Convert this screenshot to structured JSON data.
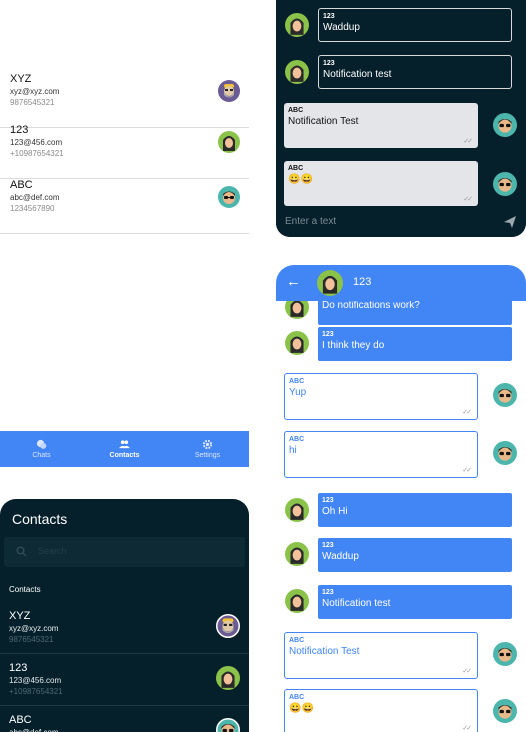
{
  "contacts": [
    {
      "name": "XYZ",
      "email": "xyz@xyz.com",
      "phone": "9876545321",
      "avatar_icon": "bearded-man-avatar-icon"
    },
    {
      "name": "123",
      "email": "123@456.com",
      "phone": "+10987654321",
      "avatar_icon": "long-hair-avatar-icon"
    },
    {
      "name": "ABC",
      "email": "abc@def.com",
      "phone": "1234567890",
      "avatar_icon": "sunglasses-avatar-icon"
    }
  ],
  "bottom_nav": {
    "items": [
      {
        "label": "Chats",
        "icon": "chat-bubbles-icon"
      },
      {
        "label": "Contacts",
        "icon": "people-icon"
      },
      {
        "label": "Settings",
        "icon": "gear-icon"
      }
    ],
    "active": "Contacts",
    "color": "#4285f4"
  },
  "dark_chat": {
    "messages": [
      {
        "from": "123",
        "text": "Waddup",
        "direction": "incoming"
      },
      {
        "from": "123",
        "text": "Notification test",
        "direction": "incoming"
      },
      {
        "from": "ABC",
        "text": "Notification Test",
        "direction": "outgoing"
      },
      {
        "from": "ABC",
        "text": "😀😀",
        "direction": "outgoing"
      }
    ],
    "input_placeholder": "Enter a text",
    "send_icon": "send-icon",
    "background": "#06202b"
  },
  "blue_chat": {
    "header": {
      "title": "123",
      "back_icon": "back-arrow-icon"
    },
    "messages": [
      {
        "from": "",
        "text": "Do notifications work?",
        "direction": "incoming"
      },
      {
        "from": "123",
        "text": "I think they do",
        "direction": "incoming"
      },
      {
        "from": "ABC",
        "text": "Yup",
        "direction": "outgoing"
      },
      {
        "from": "ABC",
        "text": "hi",
        "direction": "outgoing"
      },
      {
        "from": "123",
        "text": "Oh Hi",
        "direction": "incoming"
      },
      {
        "from": "123",
        "text": "Waddup",
        "direction": "incoming"
      },
      {
        "from": "123",
        "text": "Notification test",
        "direction": "incoming"
      },
      {
        "from": "ABC",
        "text": "Notification Test",
        "direction": "outgoing"
      },
      {
        "from": "ABC",
        "text": "😀😀",
        "direction": "outgoing"
      }
    ],
    "accent": "#4285f4"
  },
  "dark_contacts": {
    "title": "Contacts",
    "search_placeholder": "Search",
    "section_label": "Contacts",
    "search_icon": "search-icon"
  }
}
